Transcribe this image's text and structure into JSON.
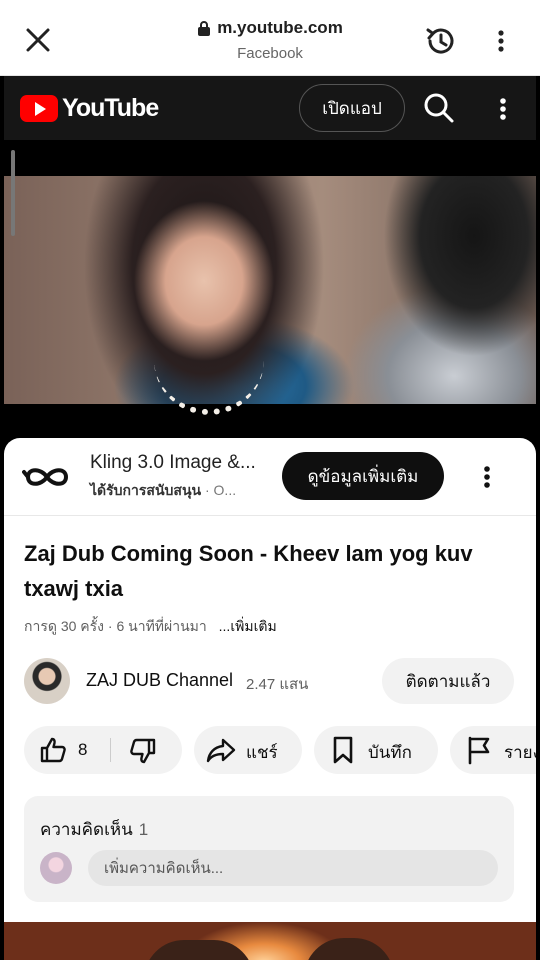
{
  "browser": {
    "url": "m.youtube.com",
    "referrer": "Facebook"
  },
  "youtube_header": {
    "logo_text": "YouTube",
    "open_app_label": "เปิดแอป"
  },
  "ad": {
    "title": "Kling 3.0 Image &...",
    "sponsored": "ได้รับการสนับสนุน",
    "sponsored_suffix": "· O...",
    "cta_label": "ดูข้อมูลเพิ่มเติม"
  },
  "video": {
    "title": "Zaj Dub Coming Soon - Kheev lam yog kuv txawj txia",
    "meta": "การดู 30 ครั้ง · 6 นาทีที่ผ่านมา",
    "more_label": "...เพิ่มเติม"
  },
  "channel": {
    "name": "ZAJ DUB Channel",
    "subscribers": "2.47 แสน",
    "subscribe_label": "ติดตามแล้ว"
  },
  "actions": {
    "like_count": "8",
    "share_label": "แชร์",
    "save_label": "บันทึก",
    "report_label": "รายง"
  },
  "comments": {
    "header": "ความคิดเห็น",
    "count": "1",
    "placeholder": "เพิ่มความคิดเห็น..."
  },
  "colors": {
    "brand_red": "#ff0000",
    "header_bg": "#161616",
    "pill_bg": "#f2f2f2"
  }
}
